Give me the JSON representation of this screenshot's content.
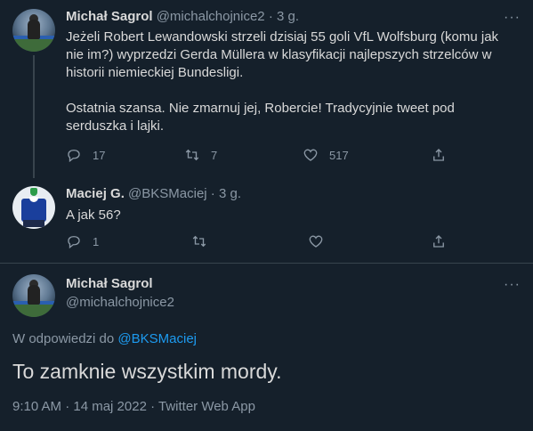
{
  "tweets": [
    {
      "name": "Michał Sagrol",
      "handle": "@michalchojnice2",
      "time": "3 g.",
      "text": "Jeżeli Robert Lewandowski strzeli dzisiaj 55 goli VfL Wolfsburg (komu jak nie im?) wyprzedzi Gerda Müllera w klasyfikacji najlepszych strzelców w historii niemieckiej Bundesligi.\n\nOstatnia szansa. Nie zmarnuj jej, Robercie! Tradycyjnie tweet pod serduszka i lajki.",
      "replies": "17",
      "retweets": "7",
      "likes": "517"
    },
    {
      "name": "Maciej G.",
      "handle": "@BKSMaciej",
      "time": "3 g.",
      "text": "A jak 56?",
      "replies": "1",
      "retweets": "",
      "likes": ""
    }
  ],
  "main_tweet": {
    "name": "Michał Sagrol",
    "handle": "@michalchojnice2",
    "reply_prefix": "W odpowiedzi do",
    "reply_mention": "@BKSMaciej",
    "text": "To zamknie wszystkim mordy.",
    "meta": "9:10 AM · 14 maj 2022 · Twitter Web App"
  },
  "separator": "·",
  "more_glyph": "···",
  "colors": {
    "background": "#15202b",
    "text": "#d9d9d9",
    "muted": "#8b98a5",
    "accent": "#1d9bf0",
    "divider": "#38444d"
  },
  "icons": [
    "reply-icon",
    "retweet-icon",
    "like-icon",
    "share-icon",
    "more-icon"
  ]
}
